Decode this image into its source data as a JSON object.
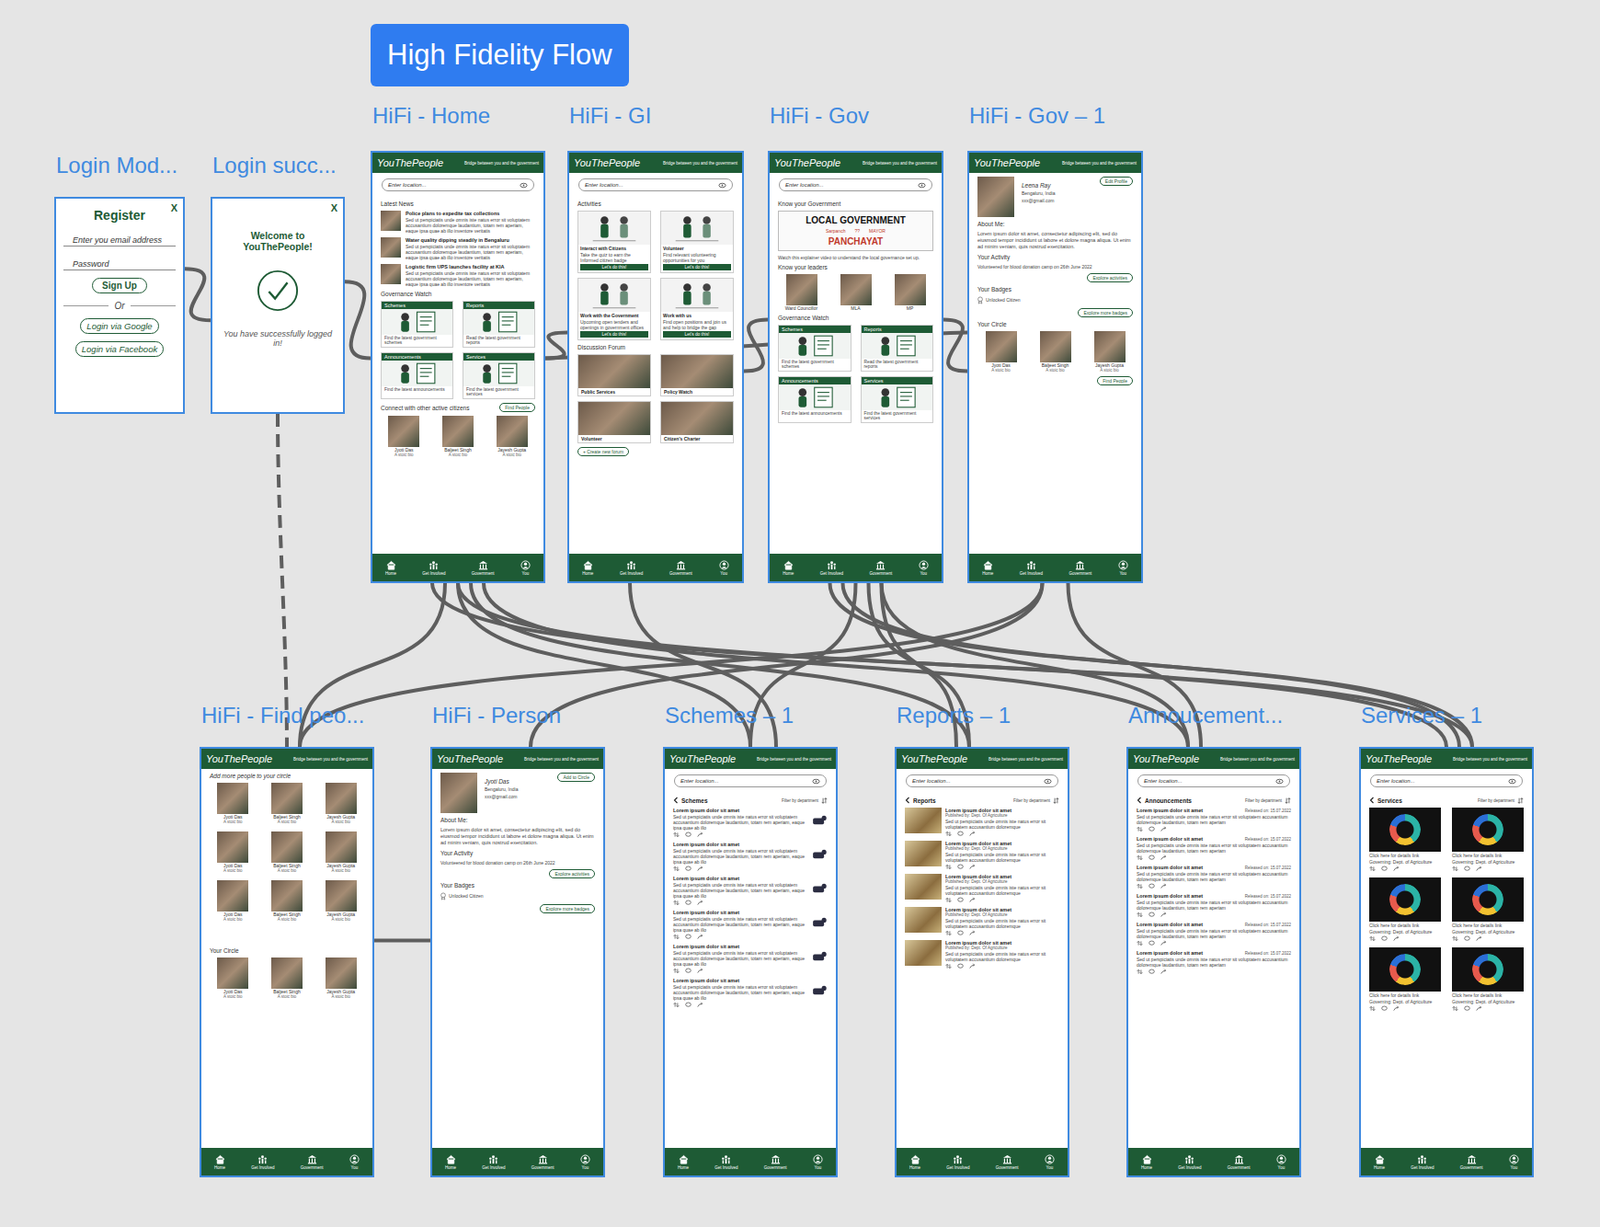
{
  "title": "High Fidelity Flow",
  "app": {
    "brand": "YouThePeople",
    "tagline": "Bridge between you and the government",
    "nav": [
      {
        "label": "Home"
      },
      {
        "label": "Get Involved"
      },
      {
        "label": "Government"
      },
      {
        "label": "You"
      }
    ]
  },
  "frames": [
    {
      "label": "Login Mod...",
      "kind": "register",
      "close": "X",
      "title": "Register",
      "fields": [
        "Enter you email address",
        "Password"
      ],
      "submit": "Sign Up",
      "divider": "Or",
      "alt_buttons": [
        "Login via Google",
        "Login via Facebook"
      ]
    },
    {
      "label": "Login succ...",
      "kind": "success",
      "close": "X",
      "title": "Welcome to YouThePeople!",
      "message": "You have successfully logged in!"
    },
    {
      "label": "HiFi - Home",
      "kind": "home",
      "search": "Enter location...",
      "news_title": "Latest News",
      "news": [
        {
          "title": "Police plans to expedite tax collections",
          "body": "Sed ut perspiciatis unde omnis iste natus error sit voluptatem accusantium doloremque laudantium, totam rem aperiam, eaque ipsa quae ab illo inventore veritatis"
        },
        {
          "title": "Water quality dipping steadily in Bengaluru",
          "body": "Sed ut perspiciatis unde omnis iste natus error sit voluptatem accusantium doloremque laudantium, totam rem aperiam, eaque ipsa quae ab illo inventore veritatis"
        },
        {
          "title": "Logistic firm UPS launches facility at KIA",
          "body": "Sed ut perspiciatis unde omnis iste natus error sit voluptatem accusantium doloremque laudantium, totam rem aperiam, eaque ipsa quae ab illo inventore veritatis"
        }
      ],
      "watch_title": "Governance Watch",
      "watch": [
        {
          "title": "Schemes",
          "text": "Find the latest government schemes"
        },
        {
          "title": "Reports",
          "text": "Read the latest government reports"
        },
        {
          "title": "Announcements",
          "text": "Find the latest announcements"
        },
        {
          "title": "Services",
          "text": "Find the latest government services"
        }
      ],
      "connect_title": "Connect with other active citizens",
      "connect_button": "Find People",
      "people": [
        {
          "name": "Jyoti Das",
          "bio": "A stoic bio"
        },
        {
          "name": "Baljeet Singh",
          "bio": "A stoic bio"
        },
        {
          "name": "Jayesh Gupta",
          "bio": "A stoic bio"
        }
      ]
    },
    {
      "label": "HiFi - GI",
      "kind": "gi",
      "search": "Enter location...",
      "activities_title": "Activities",
      "activities": [
        {
          "title": "Interact with Citizens",
          "text": "Take the quiz to earn the Informed citizen badge",
          "button": "Let's do this!"
        },
        {
          "title": "Volunteer",
          "text": "Find relevant volunteering opportunities for you",
          "button": "Let's do this!"
        },
        {
          "title": "Work with the Government",
          "text": "Upcoming open tenders and openings in government offices",
          "button": "Let's do this!"
        },
        {
          "title": "Work with us",
          "text": "Find open positions and join us and help to bridge the gap",
          "button": "Let's do this!"
        }
      ],
      "forum_title": "Discussion Forum",
      "forums": [
        {
          "title": "Public Services"
        },
        {
          "title": "Policy Watch"
        },
        {
          "title": "Volunteer"
        },
        {
          "title": "Citizen's Charter"
        }
      ],
      "forum_button": "+ Create new forum"
    },
    {
      "label": "HiFi - Gov",
      "kind": "gov",
      "search": "Enter location...",
      "know_title": "Know your Government",
      "banner_title": "LOCAL GOVERNMENT",
      "banner_tags": [
        "Sarpanch",
        "??",
        "MAYOR"
      ],
      "banner_sub": "PANCHAYAT",
      "caption": "Watch this explainer video to understand the local governance set up.",
      "leaders_title": "Know your leaders",
      "leaders": [
        {
          "name": "Ward Councillor"
        },
        {
          "name": "MLA"
        },
        {
          "name": "MP"
        }
      ],
      "watch_title": "Governance Watch",
      "watch": [
        {
          "title": "Schemes",
          "text": "Find the latest government schemes"
        },
        {
          "title": "Reports",
          "text": "Read the latest government reports"
        },
        {
          "title": "Announcements",
          "text": "Find the latest announcements"
        },
        {
          "title": "Services",
          "text": "Find the latest government services"
        }
      ]
    },
    {
      "label": "HiFi - Gov – 1",
      "kind": "profile",
      "name": "Leena Ray",
      "city": "Bengaluru, India",
      "email": "xxx@gmail.com",
      "action": "Edit Profile",
      "about_title": "About Me:",
      "about": "Lorem ipsum dolor sit amet, consectetur adipiscing elit, sed do eiusmod tempor incididunt ut labore et dolore magna aliqua. Ut enim ad minim veniam, quis nostrud exercitation.",
      "activity_title": "Your Activity",
      "activity": "Volunteered for blood donation camp on 26th June 2022",
      "activity_button": "Explore activities",
      "badges_title": "Your Badges",
      "badge": "Unlocked Citizen",
      "badges_button": "Explore more badges",
      "circle_title": "Your Circle",
      "circle": [
        {
          "name": "Jyoti Das",
          "bio": "A stoic bio"
        },
        {
          "name": "Baljeet Singh",
          "bio": "A stoic bio"
        },
        {
          "name": "Jayesh Gupta",
          "bio": "A stoic bio"
        }
      ],
      "circle_button": "Find People"
    },
    {
      "label": "HiFi - Find peo...",
      "kind": "find",
      "title": "Add more people to your circle",
      "people": [
        {
          "name": "Jyoti Das",
          "bio": "A stoic bio"
        },
        {
          "name": "Baljeet Singh",
          "bio": "A stoic bio"
        },
        {
          "name": "Jayesh Gupta",
          "bio": "A stoic bio"
        },
        {
          "name": "Jyoti Das",
          "bio": "A stoic bio"
        },
        {
          "name": "Baljeet Singh",
          "bio": "A stoic bio"
        },
        {
          "name": "Jayesh Gupta",
          "bio": "A stoic bio"
        },
        {
          "name": "Jyoti Das",
          "bio": "A stoic bio"
        },
        {
          "name": "Baljeet Singh",
          "bio": "A stoic bio"
        },
        {
          "name": "Jayesh Gupta",
          "bio": "A stoic bio"
        }
      ],
      "circle_title": "Your Circle",
      "circle": [
        {
          "name": "Jyoti Das",
          "bio": "A stoic bio"
        },
        {
          "name": "Baljeet Singh",
          "bio": "A stoic bio"
        },
        {
          "name": "Jayesh Gupta",
          "bio": "A stoic bio"
        }
      ]
    },
    {
      "label": "HiFi - Person",
      "kind": "profile",
      "name": "Jyoti Das",
      "city": "Bengaluru, India",
      "email": "xxx@gmail.com",
      "action": "Add to Circle",
      "about_title": "About Me:",
      "about": "Lorem ipsum dolor sit amet, consectetur adipiscing elit, sed do eiusmod tempor incididunt ut labore et dolore magna aliqua. Ut enim ad minim veniam, quis nostrud exercitation.",
      "activity_title": "Your Activity",
      "activity": "Volunteered for blood donation camp on 26th June 2022",
      "activity_button": "Explore activities",
      "badges_title": "Your Badges",
      "badge": "Unlocked Citizen",
      "badges_button": "Explore more badges"
    },
    {
      "label": "Schemes – 1",
      "kind": "schemes",
      "search": "Enter location...",
      "title": "Schemes",
      "filter": "Filter by department",
      "items": [
        {
          "title": "Lorem ipsum dolor sit amet",
          "body": "Sed ut perspiciatis unde omnis iste natus error sit voluptatem accusantium doloremque laudantium, totam rem aperiam, eaque ipsa quae ab illo"
        },
        {
          "title": "Lorem ipsum dolor sit amet",
          "body": "Sed ut perspiciatis unde omnis iste natus error sit voluptatem accusantium doloremque laudantium, totam rem aperiam, eaque ipsa quae ab illo"
        },
        {
          "title": "Lorem ipsum dolor sit amet",
          "body": "Sed ut perspiciatis unde omnis iste natus error sit voluptatem accusantium doloremque laudantium, totam rem aperiam, eaque ipsa quae ab illo"
        },
        {
          "title": "Lorem ipsum dolor sit amet",
          "body": "Sed ut perspiciatis unde omnis iste natus error sit voluptatem accusantium doloremque laudantium, totam rem aperiam, eaque ipsa quae ab illo"
        },
        {
          "title": "Lorem ipsum dolor sit amet",
          "body": "Sed ut perspiciatis unde omnis iste natus error sit voluptatem accusantium doloremque laudantium, totam rem aperiam, eaque ipsa quae ab illo"
        },
        {
          "title": "Lorem ipsum dolor sit amet",
          "body": "Sed ut perspiciatis unde omnis iste natus error sit voluptatem accusantium doloremque laudantium, totam rem aperiam, eaque ipsa quae ab illo"
        }
      ]
    },
    {
      "label": "Reports – 1",
      "kind": "reports",
      "search": "Enter location...",
      "title": "Reports",
      "filter": "Filter by department",
      "items": [
        {
          "title": "Lorem ipsum dolor sit amet",
          "meta": "Published by: Dept. Of Agriculture",
          "body": "Sed ut perspiciatis unde omnis iste natus error sit voluptatem accusantium doloremque"
        },
        {
          "title": "Lorem ipsum dolor sit amet",
          "meta": "Published by: Dept. Of Agriculture",
          "body": "Sed ut perspiciatis unde omnis iste natus error sit voluptatem accusantium doloremque"
        },
        {
          "title": "Lorem ipsum dolor sit amet",
          "meta": "Published by: Dept. Of Agriculture",
          "body": "Sed ut perspiciatis unde omnis iste natus error sit voluptatem accusantium doloremque"
        },
        {
          "title": "Lorem ipsum dolor sit amet",
          "meta": "Published by: Dept. Of Agriculture",
          "body": "Sed ut perspiciatis unde omnis iste natus error sit voluptatem accusantium doloremque"
        },
        {
          "title": "Lorem ipsum dolor sit amet",
          "meta": "Published by: Dept. Of Agriculture",
          "body": "Sed ut perspiciatis unde omnis iste natus error sit voluptatem accusantium doloremque"
        }
      ]
    },
    {
      "label": "Annoucement...",
      "kind": "announcements",
      "search": "Enter location...",
      "title": "Announcements",
      "filter": "Filter by department",
      "items": [
        {
          "title": "Lorem ipsum dolor sit amet",
          "meta": "Released on: 15.07.2022",
          "body": "Sed ut perspiciatis unde omnis iste natus error sit voluptatem accusantium doloremque laudantium, totam rem aperiam"
        },
        {
          "title": "Lorem ipsum dolor sit amet",
          "meta": "Released on: 15.07.2022",
          "body": "Sed ut perspiciatis unde omnis iste natus error sit voluptatem accusantium doloremque laudantium, totam rem aperiam"
        },
        {
          "title": "Lorem ipsum dolor sit amet",
          "meta": "Released on: 15.07.2022",
          "body": "Sed ut perspiciatis unde omnis iste natus error sit voluptatem accusantium doloremque laudantium, totam rem aperiam"
        },
        {
          "title": "Lorem ipsum dolor sit amet",
          "meta": "Released on: 15.07.2022",
          "body": "Sed ut perspiciatis unde omnis iste natus error sit voluptatem accusantium doloremque laudantium, totam rem aperiam"
        },
        {
          "title": "Lorem ipsum dolor sit amet",
          "meta": "Released on: 15.07.2022",
          "body": "Sed ut perspiciatis unde omnis iste natus error sit voluptatem accusantium doloremque laudantium, totam rem aperiam"
        },
        {
          "title": "Lorem ipsum dolor sit amet",
          "meta": "Released on: 15.07.2022",
          "body": "Sed ut perspiciatis unde omnis iste natus error sit voluptatem accusantium doloremque laudantium, totam rem aperiam"
        }
      ]
    },
    {
      "label": "Services – 1",
      "kind": "services",
      "search": "Enter location...",
      "title": "Services",
      "filter": "Filter by department",
      "tiles": [
        {
          "title": "Click here for details link",
          "meta": "Governing: Dept. of Agriculture"
        },
        {
          "title": "Click here for details link",
          "meta": "Governing: Dept. of Agriculture"
        },
        {
          "title": "Click here for details link",
          "meta": "Governing: Dept. of Agriculture"
        },
        {
          "title": "Click here for details link",
          "meta": "Governing: Dept. of Agriculture"
        },
        {
          "title": "Click here for details link",
          "meta": "Governing: Dept. of Agriculture"
        },
        {
          "title": "Click here for details link",
          "meta": "Governing: Dept. of Agriculture"
        }
      ]
    }
  ],
  "connections": [
    {
      "from": "Login Mod...",
      "to": "Login succ...",
      "dashed": false
    },
    {
      "from": "Login succ...",
      "to": "HiFi - Home",
      "dashed": false
    },
    {
      "from": "Login succ...",
      "to": "HiFi - Find peo...",
      "dashed": true
    },
    {
      "from": "HiFi - Home",
      "to": "HiFi - GI",
      "dashed": false
    },
    {
      "from": "HiFi - GI",
      "to": "HiFi - Gov",
      "dashed": false
    },
    {
      "from": "HiFi - Gov",
      "to": "HiFi - Gov – 1",
      "dashed": false
    },
    {
      "from": "HiFi - Gov – 1",
      "to": "HiFi - Home",
      "dashed": false
    },
    {
      "from": "HiFi - Home",
      "to": "Schemes – 1",
      "dashed": false
    },
    {
      "from": "HiFi - Home",
      "to": "Reports – 1",
      "dashed": false
    },
    {
      "from": "HiFi - Home",
      "to": "Annoucement...",
      "dashed": false
    },
    {
      "from": "HiFi - Home",
      "to": "Services – 1",
      "dashed": false
    },
    {
      "from": "HiFi - Home",
      "to": "HiFi - Find peo...",
      "dashed": false
    },
    {
      "from": "HiFi - Gov",
      "to": "Schemes – 1",
      "dashed": false
    },
    {
      "from": "HiFi - Gov",
      "to": "Reports – 1",
      "dashed": false
    },
    {
      "from": "HiFi - Gov",
      "to": "Annoucement...",
      "dashed": false
    },
    {
      "from": "HiFi - Gov",
      "to": "Services – 1",
      "dashed": false
    },
    {
      "from": "HiFi - Gov – 1",
      "to": "HiFi - Find peo...",
      "dashed": false
    },
    {
      "from": "HiFi - Find peo...",
      "to": "HiFi - Person",
      "dashed": false
    },
    {
      "from": "HiFi - Person",
      "to": "HiFi - Gov – 1",
      "dashed": false
    },
    {
      "from": "Schemes – 1",
      "to": "HiFi - GI",
      "dashed": false
    },
    {
      "from": "Reports – 1",
      "to": "HiFi - Gov",
      "dashed": false
    },
    {
      "from": "Annoucement...",
      "to": "HiFi - Gov – 1",
      "dashed": false
    },
    {
      "from": "Services – 1",
      "to": "HiFi - Home",
      "dashed": false
    },
    {
      "from": "Services – 1",
      "to": "HiFi - Gov",
      "dashed": false
    }
  ]
}
